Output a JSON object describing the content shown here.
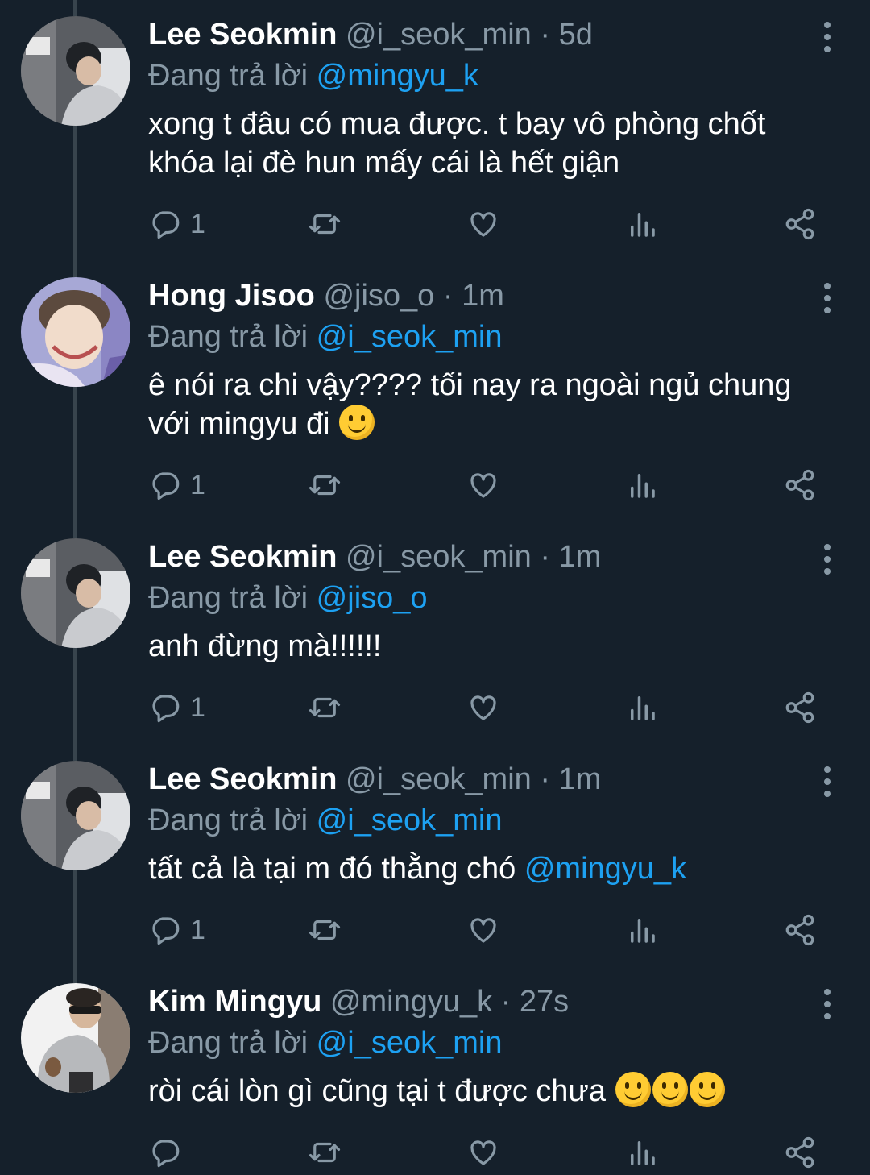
{
  "reply_prefix": "Đang trả lời",
  "tweets": [
    {
      "name": "Lee Seokmin",
      "handle": "@i_seok_min",
      "separator": "·",
      "time": "5d",
      "reply_to": "@mingyu_k",
      "text": "xong t đâu có mua được. t bay vô phòng chốt khóa lại đè hun mấy cái là hết giận",
      "reply_count": "1"
    },
    {
      "name": "Hong Jisoo",
      "handle": "@jiso_o",
      "separator": "·",
      "time": "1m",
      "reply_to": "@i_seok_min",
      "text": "ê nói ra chi vậy???? tối nay ra ngoài ngủ chung với mingyu đi",
      "reply_count": "1"
    },
    {
      "name": "Lee Seokmin",
      "handle": "@i_seok_min",
      "separator": "·",
      "time": "1m",
      "reply_to": "@jiso_o",
      "text": "anh đừng mà!!!!!!",
      "reply_count": "1"
    },
    {
      "name": "Lee Seokmin",
      "handle": "@i_seok_min",
      "separator": "·",
      "time": "1m",
      "reply_to": "@i_seok_min",
      "text": "tất cả là tại m đó thằng chó ",
      "text_mention": "@mingyu_k",
      "reply_count": "1"
    },
    {
      "name": "Kim Mingyu",
      "handle": "@mingyu_k",
      "separator": "·",
      "time": "27s",
      "reply_to": "@i_seok_min",
      "text": "ròi cái lòn gì cũng tại t được chưa ",
      "reply_count": ""
    }
  ],
  "icons": {
    "reply": "reply-icon",
    "retweet": "retweet-icon",
    "like": "heart-icon",
    "analytics": "analytics-icon",
    "share": "share-icon",
    "more": "more-vertical-icon",
    "emoji": "slightly-smiling-face-emoji"
  },
  "colors": {
    "background": "#15202b",
    "text": "#ffffff",
    "secondary": "#8899a6",
    "link": "#1da1f2",
    "thread_line": "#38444d"
  }
}
